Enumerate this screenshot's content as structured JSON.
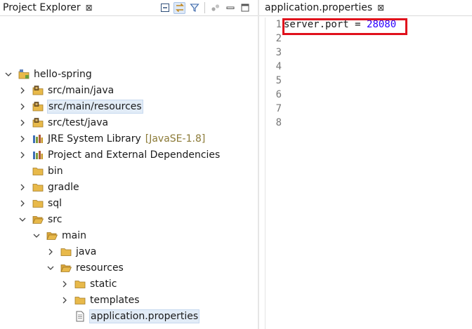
{
  "explorer": {
    "tab_title": "Project Explorer",
    "close_glyph": "⊠",
    "tree": [
      {
        "label": "hello-spring",
        "depth": 0,
        "chevron": "down",
        "icon": "project-icon"
      },
      {
        "label": "src/main/java",
        "depth": 1,
        "chevron": "right",
        "icon": "source-folder-icon"
      },
      {
        "label": "src/main/resources",
        "depth": 1,
        "chevron": "right",
        "icon": "source-folder-icon",
        "selected": true
      },
      {
        "label": "src/test/java",
        "depth": 1,
        "chevron": "right",
        "icon": "source-folder-icon"
      },
      {
        "label": "JRE System Library",
        "depth": 1,
        "chevron": "right",
        "icon": "library-icon",
        "decoration": "[JavaSE-1.8]"
      },
      {
        "label": "Project and External Dependencies",
        "depth": 1,
        "chevron": "right",
        "icon": "library-icon"
      },
      {
        "label": "bin",
        "depth": 1,
        "chevron": "none",
        "icon": "folder-icon"
      },
      {
        "label": "gradle",
        "depth": 1,
        "chevron": "right",
        "icon": "folder-icon"
      },
      {
        "label": "sql",
        "depth": 1,
        "chevron": "right",
        "icon": "folder-icon"
      },
      {
        "label": "src",
        "depth": 1,
        "chevron": "down",
        "icon": "folder-open-icon"
      },
      {
        "label": "main",
        "depth": 2,
        "chevron": "down",
        "icon": "folder-open-icon"
      },
      {
        "label": "java",
        "depth": 3,
        "chevron": "right",
        "icon": "folder-icon"
      },
      {
        "label": "resources",
        "depth": 3,
        "chevron": "down",
        "icon": "folder-open-icon"
      },
      {
        "label": "static",
        "depth": 4,
        "chevron": "right",
        "icon": "folder-icon"
      },
      {
        "label": "templates",
        "depth": 4,
        "chevron": "right",
        "icon": "folder-icon"
      },
      {
        "label": "application.properties",
        "depth": 4,
        "chevron": "none",
        "icon": "file-icon",
        "selected": true
      }
    ]
  },
  "editor": {
    "tab_title": "application.properties",
    "close_glyph": "⊠",
    "lines": [
      {
        "n": "1",
        "key": "server.port = ",
        "value": "28080"
      },
      {
        "n": "2",
        "key": "",
        "value": ""
      },
      {
        "n": "3",
        "key": "",
        "value": ""
      },
      {
        "n": "4",
        "key": "",
        "value": ""
      },
      {
        "n": "5",
        "key": "",
        "value": ""
      },
      {
        "n": "6",
        "key": "",
        "value": ""
      },
      {
        "n": "7",
        "key": "",
        "value": ""
      },
      {
        "n": "8",
        "key": "",
        "value": ""
      }
    ]
  },
  "colors": {
    "highlight_border": "#e0101c",
    "number_literal": "#2a00ff",
    "selection_bg": "#e2ecf7",
    "folder": "#e8b94a"
  }
}
